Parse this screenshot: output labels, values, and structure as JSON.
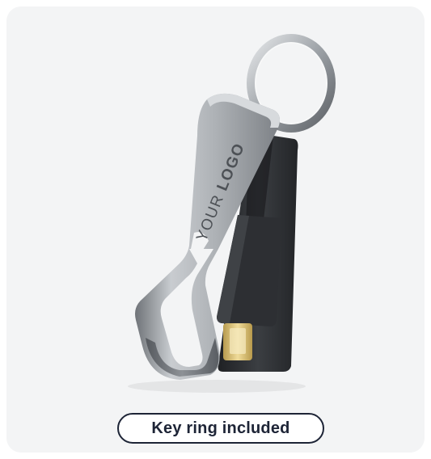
{
  "product": {
    "engraving_part1": "YOUR ",
    "engraving_part2": "LOGO",
    "image_label": "key-ring-cable-product"
  },
  "badge": {
    "label": "Key ring included"
  },
  "colors": {
    "card_background": "#f3f4f5",
    "badge_border": "#1d2436",
    "metal": "#9a9ea3",
    "cable": "#2b2d30",
    "connector_gold": "#d9c27a"
  }
}
